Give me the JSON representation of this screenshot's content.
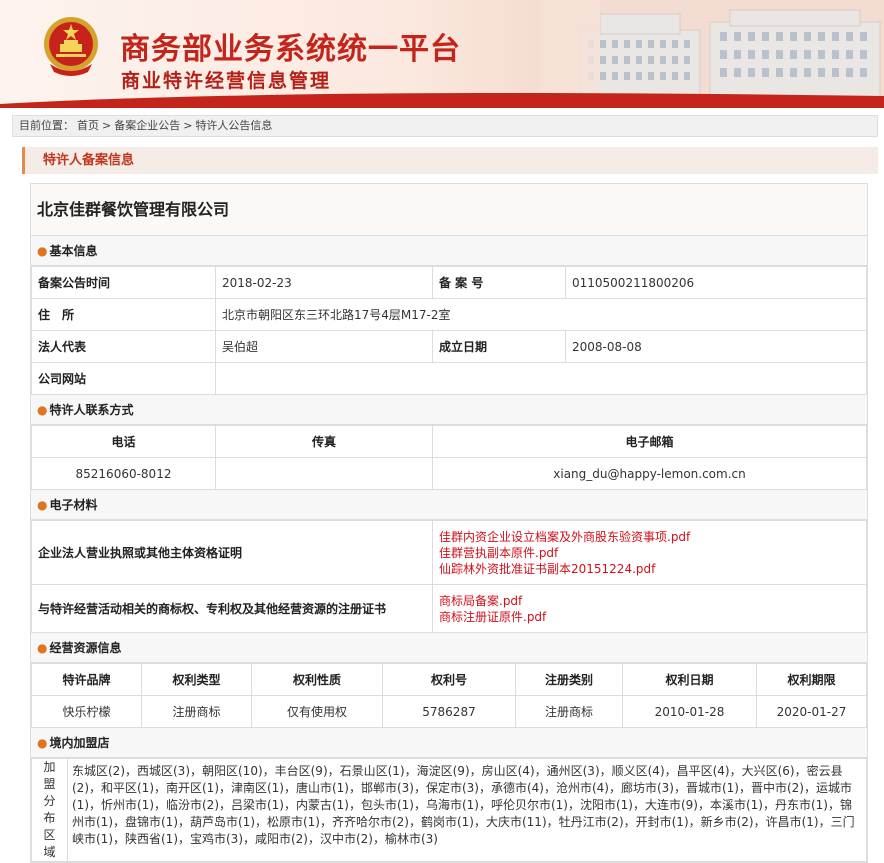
{
  "header": {
    "title": "商务部业务系统统一平台",
    "subtitle": "商业特许经营信息管理"
  },
  "breadcrumb": {
    "prefix": "目前位置：",
    "items": [
      "首页",
      "备案企业公告",
      "特许人公告信息"
    ],
    "separator": ">"
  },
  "section_title": "特许人备案信息",
  "company_name": "北京佳群餐饮管理有限公司",
  "basic": {
    "title": "基本信息",
    "announce_date_label": "备案公告时间",
    "announce_date": "2018-02-23",
    "record_no_label": "备 案 号",
    "record_no": "0110500211800206",
    "address_label": "住　所",
    "address": "北京市朝阳区东三环北路17号4层M17-2室",
    "legal_rep_label": "法人代表",
    "legal_rep": "吴伯超",
    "founded_label": "成立日期",
    "founded": "2008-08-08",
    "website_label": "公司网站",
    "website": ""
  },
  "contact": {
    "title": "特许人联系方式",
    "phone_label": "电话",
    "fax_label": "传真",
    "email_label": "电子邮箱",
    "phone": "85216060-8012",
    "fax": "",
    "email": "xiang_du@happy-lemon.com.cn"
  },
  "materials": {
    "title": "电子材料",
    "row1_label": "企业法人营业执照或其他主体资格证明",
    "row1_files": [
      "佳群内资企业设立档案及外商股东验资事项.pdf",
      "佳群营执副本原件.pdf",
      "仙踪林外资批准证书副本20151224.pdf"
    ],
    "row2_label": "与特许经营活动相关的商标权、专利权及其他经营资源的注册证书",
    "row2_files": [
      "商标局备案.pdf",
      "商标注册证原件.pdf"
    ]
  },
  "resources": {
    "title": "经营资源信息",
    "headers": [
      "特许品牌",
      "权利类型",
      "权利性质",
      "权利号",
      "注册类别",
      "权利日期",
      "权利期限"
    ],
    "row": [
      "快乐柠檬",
      "注册商标",
      "仅有使用权",
      "5786287",
      "注册商标",
      "2010-01-28",
      "2020-01-27"
    ]
  },
  "domestic": {
    "title": "境内加盟店",
    "label": "加盟分布区域",
    "areas": "东城区(2)，西城区(3)，朝阳区(10)，丰台区(9)，石景山区(1)，海淀区(9)，房山区(4)，通州区(3)，顺义区(4)，昌平区(4)，大兴区(6)，密云县(2)，和平区(1)，南开区(1)，津南区(1)，唐山市(1)，邯郸市(3)，保定市(3)，承德市(4)，沧州市(4)，廊坊市(3)，晋城市(1)，晋中市(2)，运城市(1)，忻州市(1)，临汾市(2)，吕梁市(1)，内蒙古(1)，包头市(1)，乌海市(1)，呼伦贝尔市(1)，沈阳市(1)，大连市(9)，本溪市(1)，丹东市(1)，锦州市(1)，盘锦市(1)，葫芦岛市(1)，松原市(1)，齐齐哈尔市(2)，鹤岗市(1)，大庆市(11)，牡丹江市(2)，开封市(1)，新乡市(2)，许昌市(1)，三门峡市(1)，陕西省(1)，宝鸡市(3)，咸阳市(2)，汉中市(2)，榆林市(3)"
  },
  "colors": {
    "brand_red": "#c4251b",
    "link_red": "#d0101a",
    "accent_orange": "#e07420"
  }
}
